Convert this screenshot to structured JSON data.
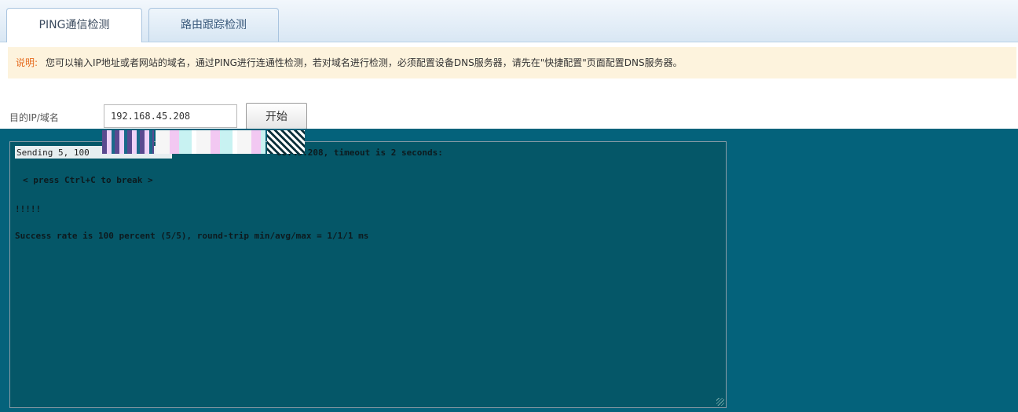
{
  "tabs": [
    {
      "label": "PING通信检测",
      "active": true
    },
    {
      "label": "路由跟踪检测",
      "active": false
    }
  ],
  "notice": {
    "label": "说明:",
    "text": "您可以输入IP地址或者网站的域名，通过PING进行连通性检测，若对域名进行检测，必须配置设备DNS服务器，请先在\"快捷配置\"页面配置DNS服务器。"
  },
  "form": {
    "target_label": "目的IP/域名",
    "target_value": "192.168.45.208",
    "start_label": "开始"
  },
  "output": {
    "line1_start": "Sending 5, 100",
    "line1_end": "68.45.208, timeout is 2 seconds:",
    "line2": "< press Ctrl+C to break >",
    "line3": "!!!!!",
    "line4": "Success rate is 100 percent (5/5), round-trip min/avg/max = 1/1/1 ms"
  },
  "colors": {
    "notice_bg": "#fdf3dd",
    "notice_label": "#e56b1f",
    "panel_bg": "#04627b",
    "output_bg": "#055768"
  }
}
